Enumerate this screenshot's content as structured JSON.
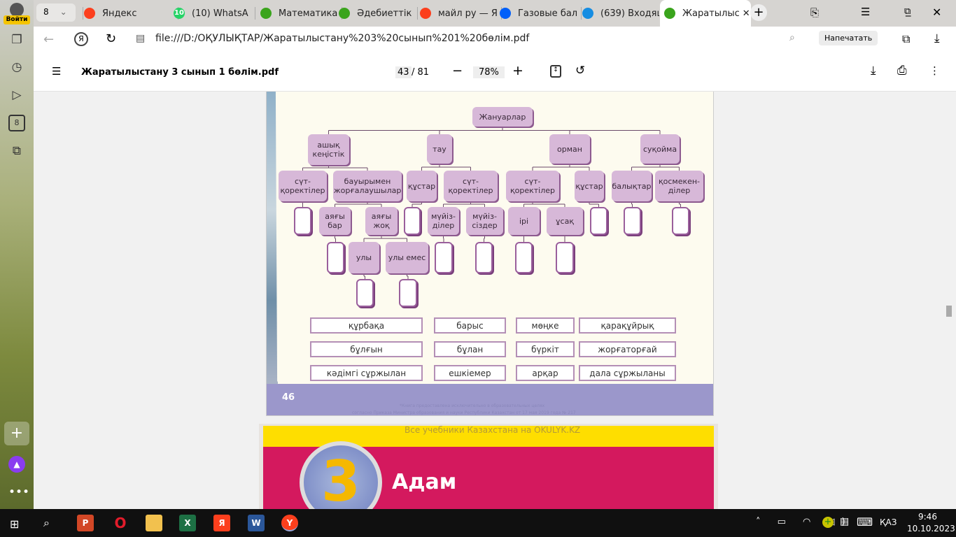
{
  "browser": {
    "login_label": "Войти",
    "tab_count": "8",
    "tabs": [
      {
        "title": "Яндекс",
        "icon": "yandex-icon",
        "color": "#fc3f1d"
      },
      {
        "title": "(10) WhatsA",
        "icon": "whatsapp-icon",
        "color": "#25d366",
        "badge": "10"
      },
      {
        "title": "Математика",
        "icon": "okulyk-icon",
        "color": "#3aa41c"
      },
      {
        "title": "Әдебиеттік",
        "icon": "okulyk-icon",
        "color": "#3aa41c"
      },
      {
        "title": "майл ру — Я",
        "icon": "yandex-icon",
        "color": "#fc3f1d"
      },
      {
        "title": "Газовые бал",
        "icon": "mail-at-icon",
        "color": "#005ff9"
      },
      {
        "title": "(639) Входящ",
        "icon": "mail-envelope-icon",
        "color": "#168de2"
      },
      {
        "title": "Жаратылыс",
        "icon": "okulyk-icon",
        "color": "#3aa41c",
        "active": true
      }
    ],
    "url": "file:///D:/ОҚУЛЫҚТАР/Жаратылыстану%203%20сынып%201%20бөлім.pdf",
    "print_button": "Напечатать"
  },
  "pdf": {
    "filename": "Жаратылыстану 3 сынып 1 бөлім.pdf",
    "current_page": "43",
    "total_pages": "/ 81",
    "zoom": "78%"
  },
  "page": {
    "page_number": "46",
    "footer_note_1": "*Книга предоставлена исключительно в образовательных целях",
    "footer_note_2": "согласно Приказа Министра образования и науки Республики Казахстан от 17 мая 2019 года № 217",
    "watermark": "Все учебники Казахстана на OKULYK.KZ",
    "chapter_number": "3",
    "chapter_title": "Адам"
  },
  "diagram": {
    "root": "Жануарлар",
    "habitats": [
      "ашық кеңістік",
      "тау",
      "орман",
      "суқойма"
    ],
    "groups": [
      "сүт-қоректілер",
      "бауырымен жорғалаушылар",
      "құстар",
      "сүт-қоректілер",
      "сүт-қоректілер",
      "құстар",
      "балықтар",
      "қосмекен-ділер"
    ],
    "subgroups": [
      "аяғы бар",
      "аяғы жоқ",
      "мүйіз-ділер",
      "мүйіз-сіздер",
      "ірі",
      "ұсақ",
      "улы",
      "улы емес"
    ]
  },
  "words": [
    [
      "құрбақа",
      "барыс",
      "мөңке",
      "қарақұйрық"
    ],
    [
      "бұлғын",
      "бұлан",
      "бүркіт",
      "жорғаторғай"
    ],
    [
      "кәдімгі сұржылан",
      "ешкіемер",
      "арқар",
      "дала сұржыланы"
    ]
  ],
  "taskbar": {
    "lang": "ҚАЗ",
    "time": "9:46",
    "date": "10.10.2023"
  }
}
